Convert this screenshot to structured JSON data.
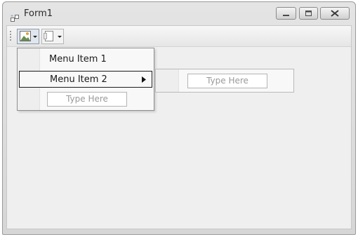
{
  "window": {
    "title": "Form1",
    "icon": "form-icon",
    "controls": [
      "minimize-icon",
      "maximize-icon",
      "close-icon"
    ]
  },
  "toolstrip": {
    "items": [
      {
        "icon": "image-icon",
        "dropdown": true
      },
      {
        "icon": "document-icon",
        "dropdown": true
      }
    ]
  },
  "dropdown_menu": {
    "items": [
      {
        "label": "Menu Item 1",
        "has_submenu": false
      },
      {
        "label": "Menu Item 2",
        "has_submenu": true
      }
    ],
    "placeholder": "Type Here"
  },
  "submenu": {
    "placeholder": "Type Here"
  },
  "colors": {
    "client_bg": "#efefef",
    "menu_border": "#8e8e8e",
    "highlight_border": "#1c1c1c"
  }
}
